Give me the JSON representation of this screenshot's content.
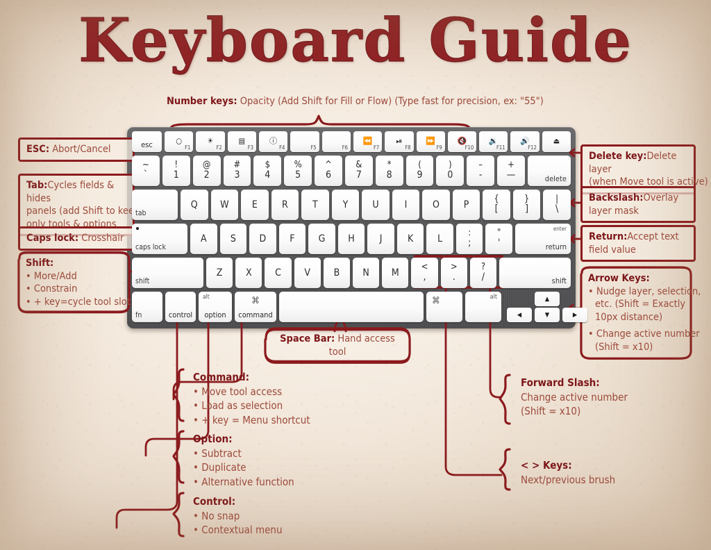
{
  "title": "Keyboard Guide",
  "top_annotation": {
    "label": "Number keys:",
    "text": "Opacity (Add Shift for Fill or Flow) (Type fast for precision, ex: \"55\")"
  },
  "left_boxes": [
    {
      "label": "ESC:",
      "lines": [
        "Abort/Cancel"
      ]
    },
    {
      "label": "Tab:",
      "lines": [
        "Cycles fields & hides",
        "panels (add Shift to keep",
        "only tools & options"
      ]
    },
    {
      "label": "Caps lock:",
      "lines": [
        "Crosshair"
      ]
    }
  ],
  "shift_box": {
    "label": "Shift:",
    "items": [
      "More/Add",
      "Constrain",
      "+ key=cycle tool slot"
    ]
  },
  "right_boxes": [
    {
      "label": "Delete key:",
      "lines": [
        "Delete layer",
        "(when Move tool is active)"
      ]
    },
    {
      "label": "Backslash:",
      "lines": [
        "Overlay",
        "layer mask"
      ]
    },
    {
      "label": "Return:",
      "lines": [
        "Accept text",
        "field value"
      ]
    }
  ],
  "arrow_box": {
    "label": "Arrow Keys:",
    "items": [
      [
        "Nudge layer, selection,",
        "etc. (Shift = Exactly",
        "10px distance)"
      ],
      [
        "Change active number",
        "(Shift = x10)"
      ]
    ]
  },
  "space_box": {
    "label": "Space Bar:",
    "text": "Hand access tool"
  },
  "bottom_left_blocks": [
    {
      "label": "Command:",
      "items": [
        "Move tool access",
        "Load as selection",
        "+ key = Menu shortcut"
      ]
    },
    {
      "label": "Option:",
      "items": [
        "Subtract",
        "Duplicate",
        "Alternative function"
      ]
    },
    {
      "label": "Control:",
      "items": [
        "No snap",
        "Contextual menu"
      ]
    }
  ],
  "bottom_right_blocks": [
    {
      "label": "Forward Slash:",
      "lines": [
        "Change active number",
        "(Shift = x10)"
      ]
    },
    {
      "label": "< > Keys:",
      "lines": [
        "Next/previous brush"
      ]
    }
  ],
  "keyboard": {
    "function_row": [
      {
        "name": "esc-key",
        "label": "esc",
        "width": "w-esc",
        "style": "bl-center"
      },
      {
        "name": "f1-key",
        "fn": "F1",
        "icon": "brightness-down-icon",
        "glyph": "○"
      },
      {
        "name": "f2-key",
        "fn": "F2",
        "icon": "brightness-up-icon",
        "glyph": "☀"
      },
      {
        "name": "f3-key",
        "fn": "F3",
        "icon": "mission-control-icon",
        "glyph": "▤"
      },
      {
        "name": "f4-key",
        "fn": "F4",
        "icon": "dashboard-icon",
        "glyph": "ⓘ"
      },
      {
        "name": "f5-key",
        "fn": "F5",
        "icon": "blank-icon",
        "glyph": ""
      },
      {
        "name": "f6-key",
        "fn": "F6",
        "icon": "blank-icon",
        "glyph": ""
      },
      {
        "name": "f7-key",
        "fn": "F7",
        "icon": "rewind-icon",
        "glyph": "⏪"
      },
      {
        "name": "f8-key",
        "fn": "F8",
        "icon": "play-pause-icon",
        "glyph": "⏯"
      },
      {
        "name": "f9-key",
        "fn": "F9",
        "icon": "fast-forward-icon",
        "glyph": "⏩"
      },
      {
        "name": "f10-key",
        "fn": "F10",
        "icon": "mute-icon",
        "glyph": "🔇"
      },
      {
        "name": "f11-key",
        "fn": "F11",
        "icon": "volume-down-icon",
        "glyph": "🔉"
      },
      {
        "name": "f12-key",
        "fn": "F12",
        "icon": "volume-up-icon",
        "glyph": "🔊"
      },
      {
        "name": "eject-key",
        "fn": "",
        "icon": "eject-icon",
        "glyph": "⏏"
      }
    ],
    "number_row": [
      {
        "name": "backtick-key",
        "up": "~",
        "lo": "`"
      },
      {
        "name": "key-1",
        "up": "!",
        "lo": "1"
      },
      {
        "name": "key-2",
        "up": "@",
        "lo": "2"
      },
      {
        "name": "key-3",
        "up": "#",
        "lo": "3"
      },
      {
        "name": "key-4",
        "up": "$",
        "lo": "4"
      },
      {
        "name": "key-5",
        "up": "%",
        "lo": "5"
      },
      {
        "name": "key-6",
        "up": "^",
        "lo": "6"
      },
      {
        "name": "key-7",
        "up": "&",
        "lo": "7"
      },
      {
        "name": "key-8",
        "up": "*",
        "lo": "8"
      },
      {
        "name": "key-9",
        "up": "(",
        "lo": "9"
      },
      {
        "name": "key-0",
        "up": ")",
        "lo": "0"
      },
      {
        "name": "minus-key",
        "up": "–",
        "lo": "-"
      },
      {
        "name": "equals-key",
        "up": "+",
        "lo": "—"
      }
    ],
    "delete_key": {
      "name": "delete-key",
      "label": "delete"
    },
    "tab_key": {
      "name": "tab-key",
      "label": "tab"
    },
    "qwerty_row": [
      {
        "name": "key-q",
        "label": "Q"
      },
      {
        "name": "key-w",
        "label": "W"
      },
      {
        "name": "key-e",
        "label": "E"
      },
      {
        "name": "key-r",
        "label": "R"
      },
      {
        "name": "key-t",
        "label": "T"
      },
      {
        "name": "key-y",
        "label": "Y"
      },
      {
        "name": "key-u",
        "label": "U"
      },
      {
        "name": "key-i",
        "label": "I"
      },
      {
        "name": "key-o",
        "label": "O"
      },
      {
        "name": "key-p",
        "label": "P"
      }
    ],
    "qwerty_brackets": [
      {
        "name": "left-bracket-key",
        "up": "{",
        "lo": "["
      },
      {
        "name": "right-bracket-key",
        "up": "}",
        "lo": "]"
      },
      {
        "name": "backslash-key",
        "up": "|",
        "lo": "\\"
      }
    ],
    "caps_key": {
      "name": "caps-lock-key",
      "label": "caps lock"
    },
    "home_row": [
      {
        "name": "key-a",
        "label": "A"
      },
      {
        "name": "key-s",
        "label": "S"
      },
      {
        "name": "key-d",
        "label": "D"
      },
      {
        "name": "key-f",
        "label": "F"
      },
      {
        "name": "key-g",
        "label": "G"
      },
      {
        "name": "key-h",
        "label": "H"
      },
      {
        "name": "key-j",
        "label": "J"
      },
      {
        "name": "key-k",
        "label": "K"
      },
      {
        "name": "key-l",
        "label": "L"
      }
    ],
    "home_punct": [
      {
        "name": "semicolon-key",
        "up": ":",
        "lo": ";"
      },
      {
        "name": "quote-key",
        "up": "\"",
        "lo": "'"
      }
    ],
    "return_key": {
      "name": "return-key",
      "top": "enter",
      "label": "return"
    },
    "shift_left": {
      "name": "left-shift-key",
      "label": "shift"
    },
    "shift_row": [
      {
        "name": "key-z",
        "label": "Z"
      },
      {
        "name": "key-x",
        "label": "X"
      },
      {
        "name": "key-c",
        "label": "C"
      },
      {
        "name": "key-v",
        "label": "V"
      },
      {
        "name": "key-b",
        "label": "B"
      },
      {
        "name": "key-n",
        "label": "N"
      },
      {
        "name": "key-m",
        "label": "M"
      }
    ],
    "shift_punct": [
      {
        "name": "comma-key",
        "up": "<",
        "lo": ","
      },
      {
        "name": "period-key",
        "up": ">",
        "lo": "."
      },
      {
        "name": "slash-key",
        "up": "?",
        "lo": "/"
      }
    ],
    "shift_right": {
      "name": "right-shift-key",
      "label": "shift"
    },
    "bottom_row": {
      "fn": {
        "name": "fn-key",
        "label": "fn"
      },
      "control": {
        "name": "control-key",
        "label": "control"
      },
      "option": {
        "name": "option-key",
        "top": "alt",
        "label": "option"
      },
      "command": {
        "name": "command-key",
        "top": "⌘",
        "label": "command"
      },
      "space": {
        "name": "space-bar",
        "label": ""
      },
      "command_right": {
        "name": "command-right-key",
        "top": "⌘",
        "label": ""
      },
      "alt_right": {
        "name": "alt-right-key",
        "top": "alt",
        "label": ""
      },
      "arrow_left": {
        "name": "arrow-left-key",
        "glyph": "◀"
      },
      "arrow_up": {
        "name": "arrow-up-key",
        "glyph": "▲"
      },
      "arrow_down": {
        "name": "arrow-down-key",
        "glyph": "▼"
      },
      "arrow_right": {
        "name": "arrow-right-key",
        "glyph": "▶"
      }
    }
  },
  "colors": {
    "accent": "#8b1a1d",
    "body_text": "#9c4a3c",
    "background": "#f2e7da",
    "keyboard_body": "#5a5a5c"
  }
}
